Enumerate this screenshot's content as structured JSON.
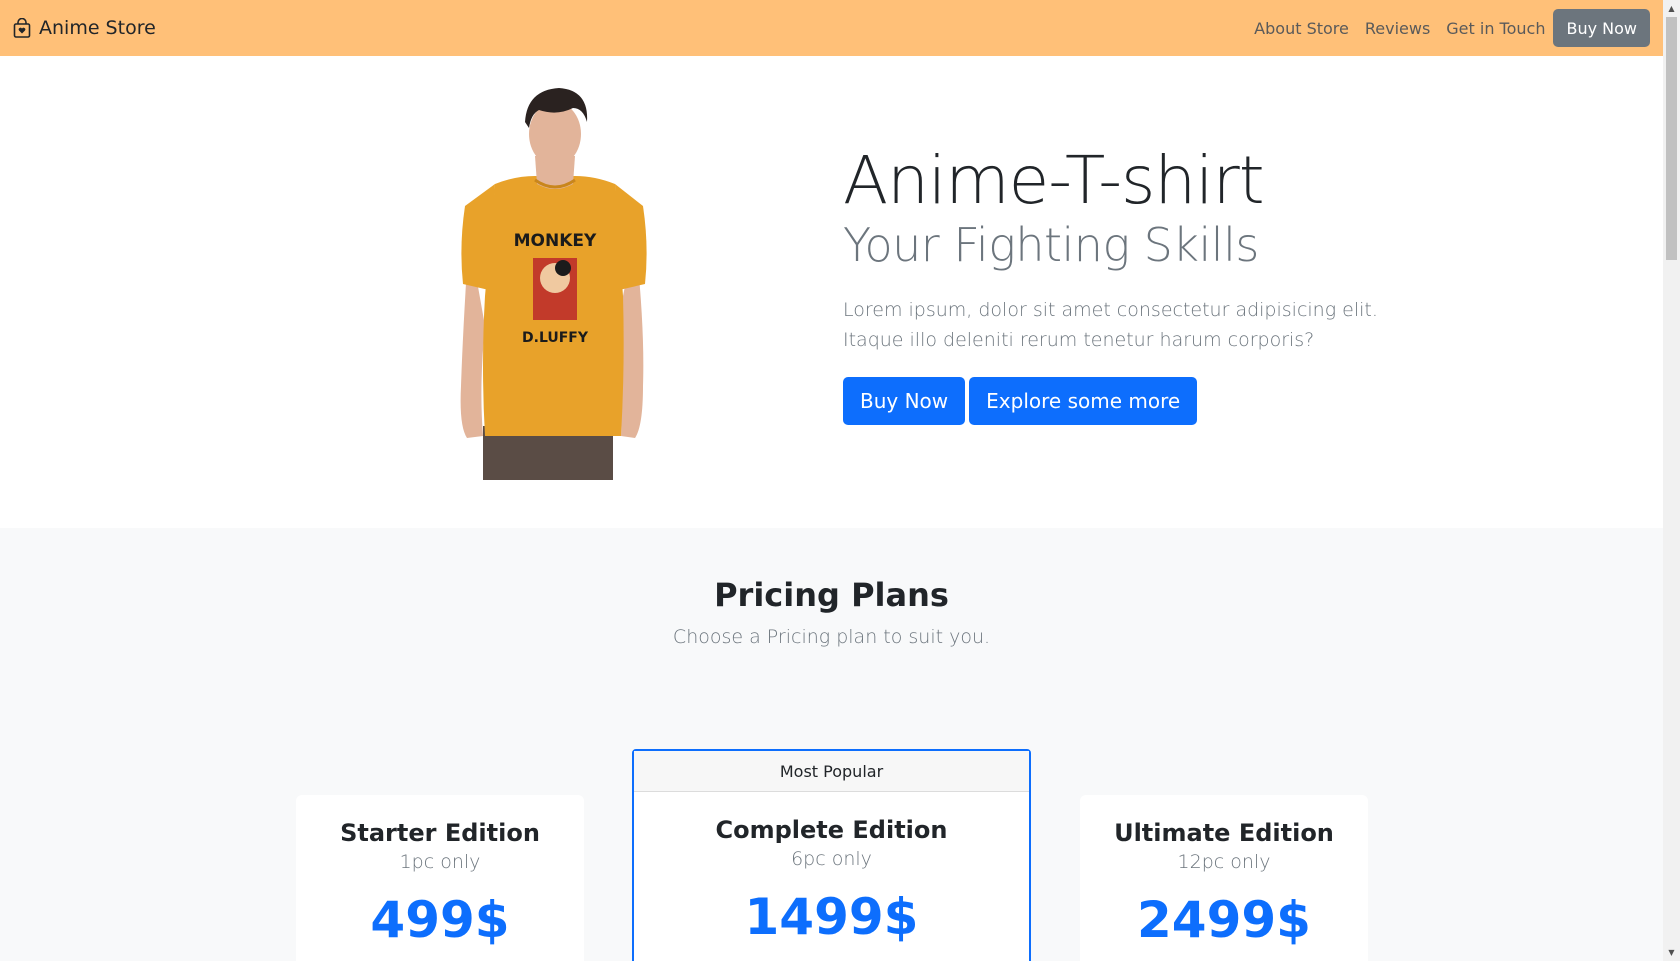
{
  "navbar": {
    "brand": "Anime Store",
    "links": [
      "About Store",
      "Reviews",
      "Get in Touch"
    ],
    "cta": "Buy Now",
    "bg_color": "#ffc078"
  },
  "hero": {
    "title": "Anime-T-shirt",
    "subtitle": "Your Fighting Skills",
    "description": "Lorem ipsum, dolor sit amet consectetur adipisicing elit. Itaque illo deleniti rerum tenetur harum corporis?",
    "buy_label": "Buy Now",
    "explore_label": "Explore some more",
    "shirt_print_top": "MONKEY",
    "shirt_print_bottom": "D.LUFFY"
  },
  "pricing": {
    "title": "Pricing Plans",
    "subtitle": "Choose a Pricing plan to suit you.",
    "plans": [
      {
        "name": "Starter Edition",
        "qty": "1pc only",
        "price": "499$"
      },
      {
        "name": "Complete Edition",
        "qty": "6pc only",
        "price": "1499$",
        "badge": "Most Popular"
      },
      {
        "name": "Ultimate Edition",
        "qty": "12pc only",
        "price": "2499$"
      }
    ]
  },
  "colors": {
    "primary": "#0d6efd",
    "secondary": "#6c757d",
    "shirt": "#e8a22a"
  },
  "icons": {
    "brand": "shopping-bag-icon"
  }
}
